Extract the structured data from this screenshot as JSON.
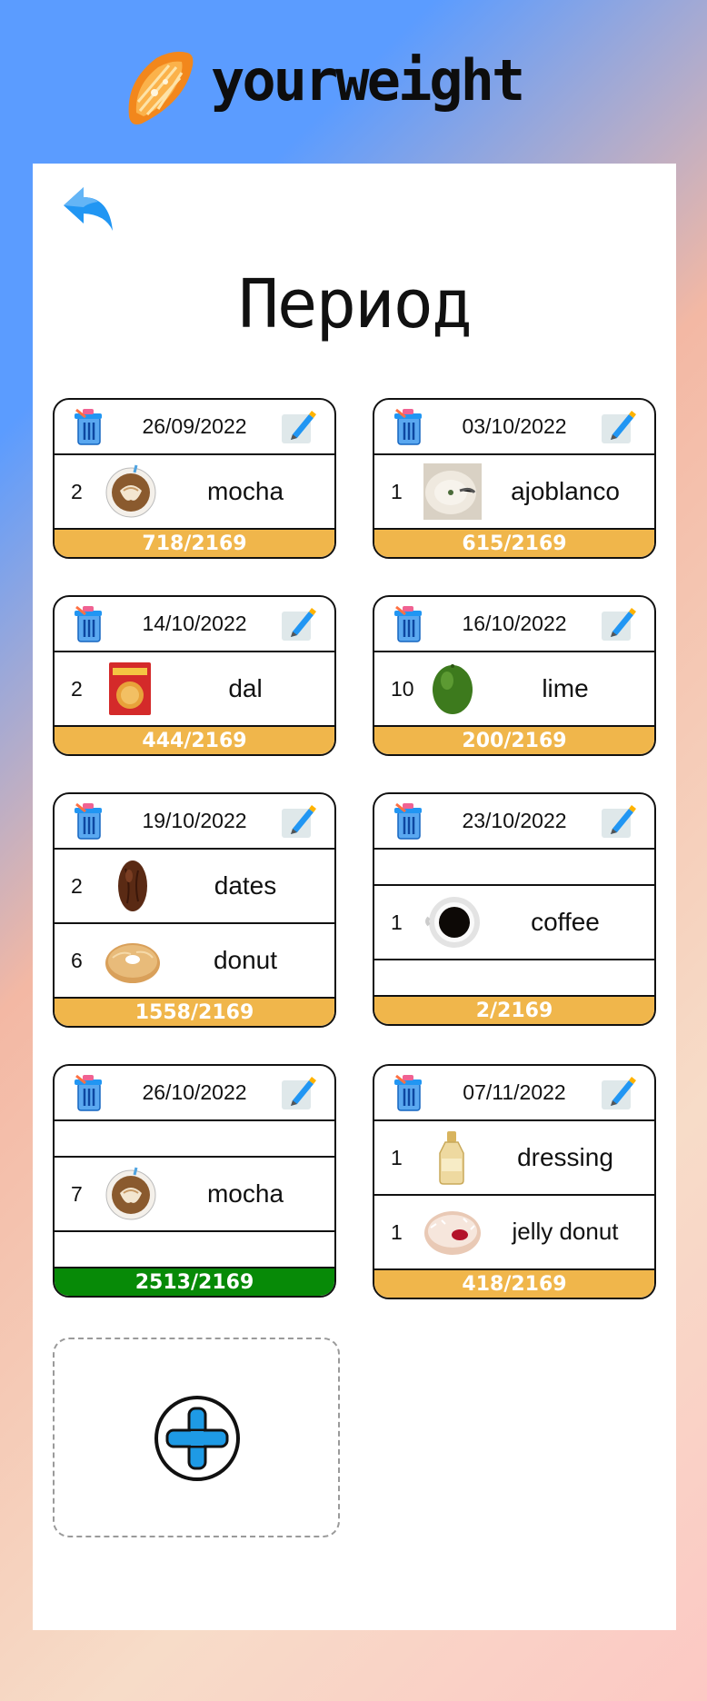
{
  "app": {
    "title": "yourweight"
  },
  "page": {
    "title": "Период"
  },
  "colors": {
    "progress_normal": "#f0b64b",
    "progress_over": "#078a07",
    "accent_blue": "#2196f3"
  },
  "icons": {
    "back": "back-arrow-icon",
    "delete": "trash-icon",
    "edit": "pencil-icon",
    "add": "plus-circle-icon",
    "logo": "orange-slice-icon"
  },
  "cards": [
    {
      "date": "26/09/2022",
      "items": [
        {
          "qty": "2",
          "name": "mocha",
          "image": "mocha"
        }
      ],
      "progress": "718/2169",
      "over_limit": false
    },
    {
      "date": "03/10/2022",
      "items": [
        {
          "qty": "1",
          "name": "ajoblanco",
          "image": "ajoblanco"
        }
      ],
      "progress": "615/2169",
      "over_limit": false
    },
    {
      "date": "14/10/2022",
      "items": [
        {
          "qty": "2",
          "name": "dal",
          "image": "dal"
        }
      ],
      "progress": "444/2169",
      "over_limit": false
    },
    {
      "date": "16/10/2022",
      "items": [
        {
          "qty": "10",
          "name": "lime",
          "image": "lime"
        }
      ],
      "progress": "200/2169",
      "over_limit": false
    },
    {
      "date": "19/10/2022",
      "items": [
        {
          "qty": "2",
          "name": "dates",
          "image": "dates"
        },
        {
          "qty": "6",
          "name": "donut",
          "image": "donut"
        }
      ],
      "progress": "1558/2169",
      "over_limit": false
    },
    {
      "date": "23/10/2022",
      "items": [
        {
          "qty": "1",
          "name": "coffee",
          "image": "coffee"
        }
      ],
      "progress": "2/2169",
      "over_limit": false
    },
    {
      "date": "26/10/2022",
      "items": [
        {
          "qty": "7",
          "name": "mocha",
          "image": "mocha"
        }
      ],
      "progress": "2513/2169",
      "over_limit": true
    },
    {
      "date": "07/11/2022",
      "items": [
        {
          "qty": "1",
          "name": "dressing",
          "image": "dressing"
        },
        {
          "qty": "1",
          "name": "jelly donut",
          "image": "jelly-donut"
        }
      ],
      "progress": "418/2169",
      "over_limit": false
    }
  ]
}
